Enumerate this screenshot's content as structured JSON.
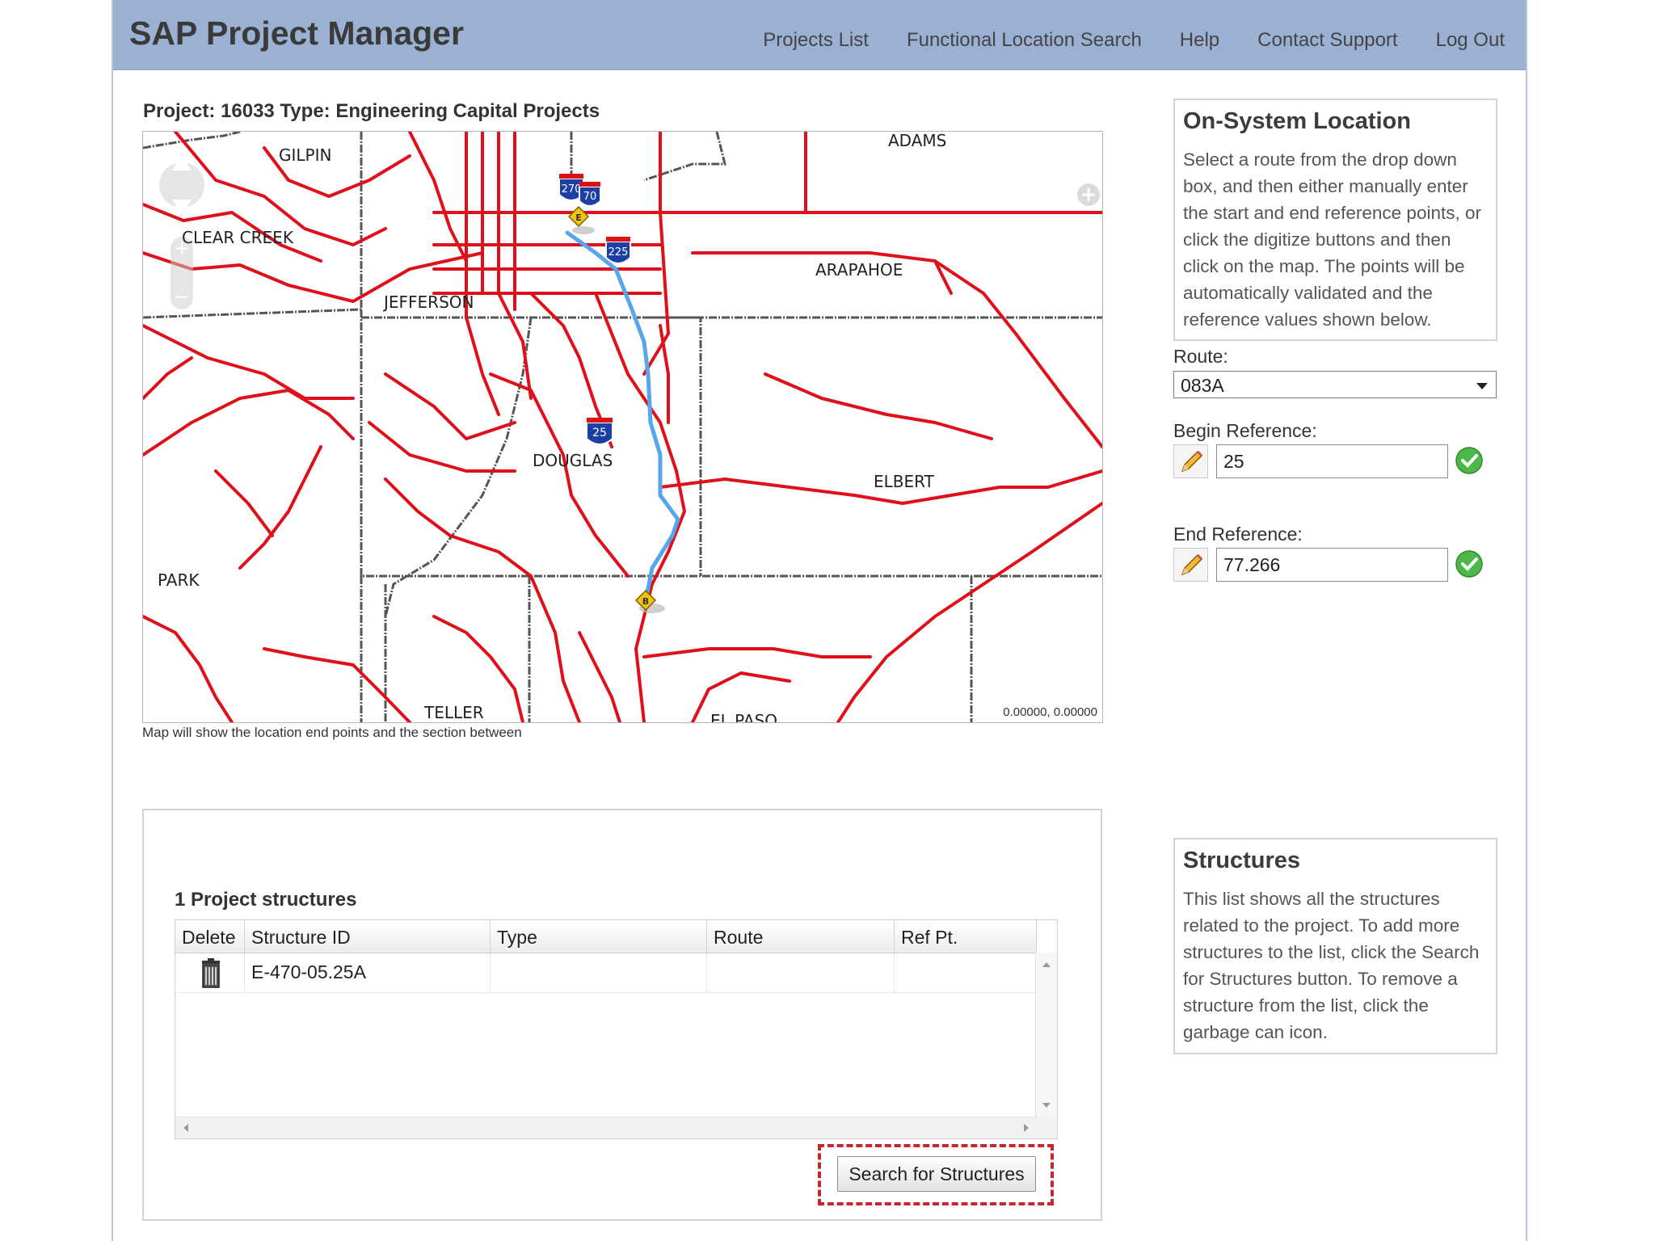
{
  "header": {
    "app_title": "SAP Project Manager",
    "nav": [
      "Projects List",
      "Functional Location Search",
      "Help",
      "Contact Support",
      "Log Out"
    ]
  },
  "project": {
    "title": "Project: 16033 Type: Engineering Capital Projects"
  },
  "map": {
    "county_labels": [
      "ADAMS",
      "GILPIN",
      "CLEAR CREEK",
      "ARAPAHOE",
      "JEFFERSON",
      "DOUGLAS",
      "ELBERT",
      "PARK",
      "TELLER",
      "EL PASO"
    ],
    "shield_labels": [
      "270",
      "70",
      "225",
      "25"
    ],
    "marker_begin": "B",
    "marker_end": "E",
    "coords": "0.00000, 0.00000",
    "caption": "Map will show the location end points and the section between",
    "colors": {
      "roads": "#e0101a",
      "route": "#55a6ec",
      "boundaries": "#555555"
    }
  },
  "onsystem": {
    "title": "On-System Location",
    "text": "Select a route from the drop down box, and then either manually enter the start and end reference points, or click the digitize buttons and then click on the map. The points will be automatically validated and the reference values shown below.",
    "route_label": "Route:",
    "route_value": "083A",
    "begin_label": "Begin Reference:",
    "begin_value": "25",
    "end_label": "End Reference:",
    "end_value": "77.266"
  },
  "structures": {
    "count_label": "1 Project structures",
    "columns": [
      "Delete",
      "Structure ID",
      "Type",
      "Route",
      "Ref Pt."
    ],
    "rows": [
      {
        "structure_id": "E-470-05.25A",
        "type": "",
        "route": "",
        "ref_pt": ""
      }
    ],
    "search_button": "Search for Structures",
    "help_title": "Structures",
    "help_text": "This list shows all the structures related to the project. To add more structures to the list, click the Search for Structures button. To remove a structure from the list, click the garbage can icon."
  }
}
